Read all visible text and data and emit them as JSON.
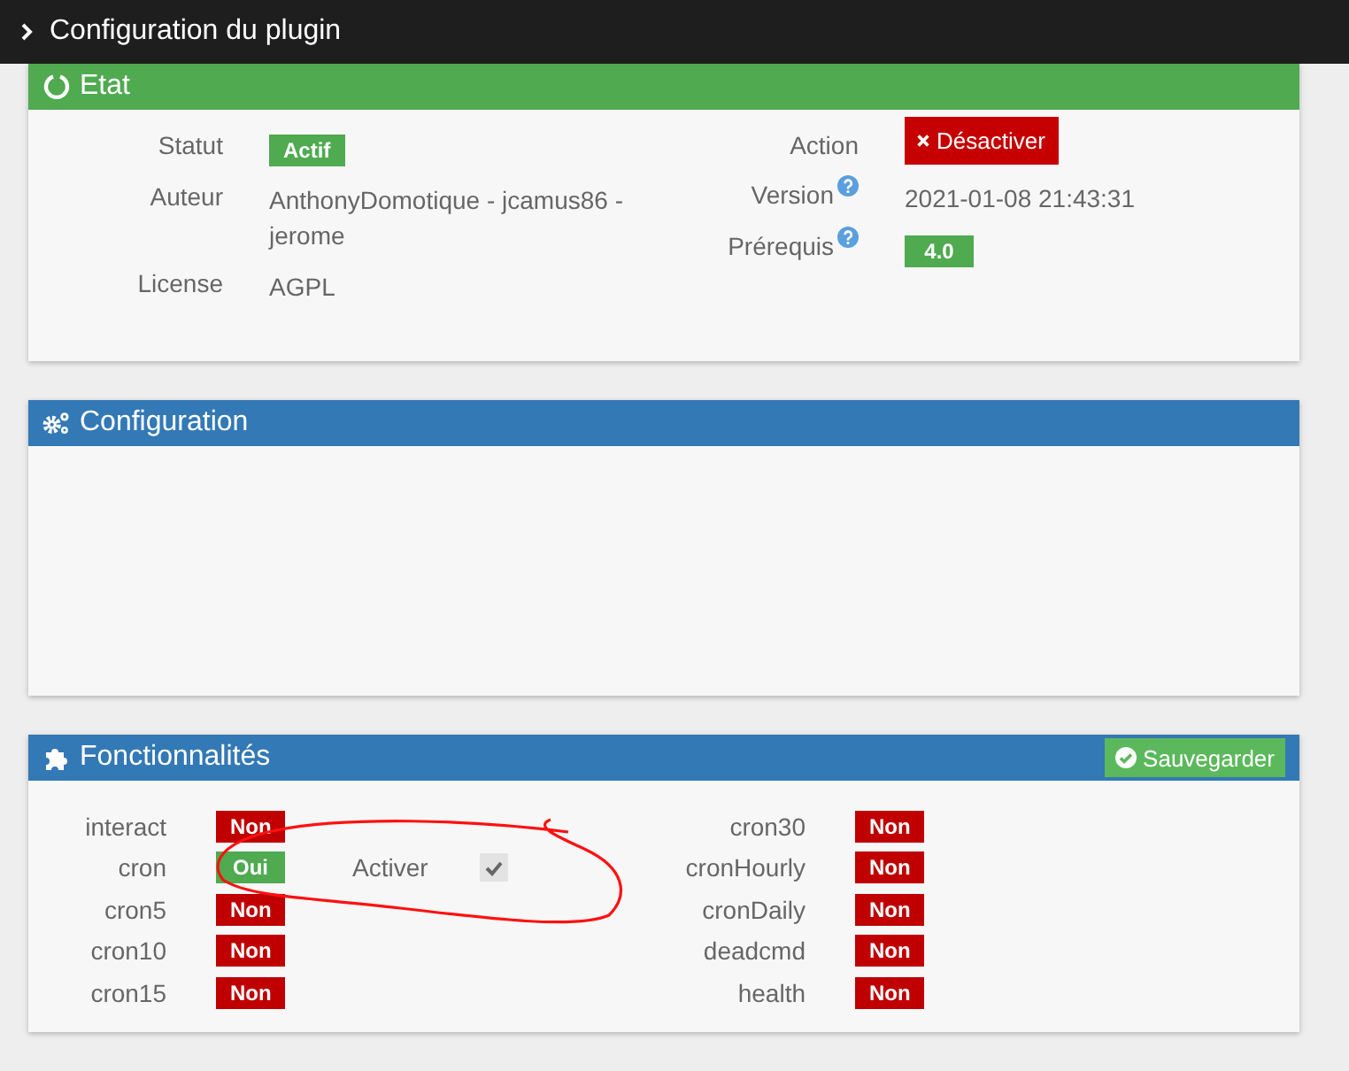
{
  "topbar": {
    "title": "Configuration du plugin"
  },
  "etat": {
    "title": "Etat",
    "fields": [
      {
        "label": "Statut",
        "kind": "badge",
        "value": "Actif",
        "on": true
      },
      {
        "label": "Auteur",
        "kind": "text",
        "value": "AnthonyDomotique - jcamus86 - jerome"
      },
      {
        "label": "License",
        "kind": "text",
        "value": "AGPL"
      }
    ],
    "right_fields": [
      {
        "label": "Action",
        "kind": "button",
        "value": "Désactiver",
        "help": false
      },
      {
        "label": "Version",
        "kind": "text",
        "value": "2021-01-08 21:43:31",
        "help": true
      },
      {
        "label": "Prérequis",
        "kind": "badge",
        "value": "4.0",
        "on": true,
        "help": true
      }
    ]
  },
  "configuration": {
    "title": "Configuration"
  },
  "fonctionnalites": {
    "title": "Fonctionnalités",
    "save_button": "Sauvegarder",
    "left": [
      {
        "label": "interact",
        "value": "Non",
        "on": false
      },
      {
        "label": "cron",
        "value": "Oui",
        "on": true,
        "option": {
          "label": "Activer",
          "checked": true
        }
      },
      {
        "label": "cron5",
        "value": "Non",
        "on": false
      },
      {
        "label": "cron10",
        "value": "Non",
        "on": false
      },
      {
        "label": "cron15",
        "value": "Non",
        "on": false
      }
    ],
    "right": [
      {
        "label": "cron30",
        "value": "Non",
        "on": false
      },
      {
        "label": "cronHourly",
        "value": "Non",
        "on": false
      },
      {
        "label": "cronDaily",
        "value": "Non",
        "on": false
      },
      {
        "label": "deadcmd",
        "value": "Non",
        "on": false
      },
      {
        "label": "health",
        "value": "Non",
        "on": false
      }
    ]
  }
}
